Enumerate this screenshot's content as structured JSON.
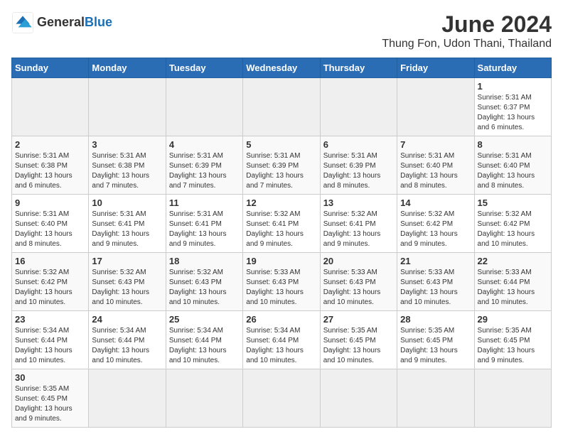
{
  "header": {
    "logo_general": "General",
    "logo_blue": "Blue",
    "title": "June 2024",
    "subtitle": "Thung Fon, Udon Thani, Thailand"
  },
  "calendar": {
    "weekdays": [
      "Sunday",
      "Monday",
      "Tuesday",
      "Wednesday",
      "Thursday",
      "Friday",
      "Saturday"
    ],
    "weeks": [
      [
        {
          "day": "",
          "empty": true
        },
        {
          "day": "",
          "empty": true
        },
        {
          "day": "",
          "empty": true
        },
        {
          "day": "",
          "empty": true
        },
        {
          "day": "",
          "empty": true
        },
        {
          "day": "",
          "empty": true
        },
        {
          "day": "1",
          "sunrise": "5:31 AM",
          "sunset": "6:37 PM",
          "daylight": "13 hours and 6 minutes."
        }
      ],
      [
        {
          "day": "2",
          "sunrise": "5:31 AM",
          "sunset": "6:38 PM",
          "daylight": "13 hours and 6 minutes."
        },
        {
          "day": "3",
          "sunrise": "5:31 AM",
          "sunset": "6:38 PM",
          "daylight": "13 hours and 7 minutes."
        },
        {
          "day": "4",
          "sunrise": "5:31 AM",
          "sunset": "6:39 PM",
          "daylight": "13 hours and 7 minutes."
        },
        {
          "day": "5",
          "sunrise": "5:31 AM",
          "sunset": "6:39 PM",
          "daylight": "13 hours and 7 minutes."
        },
        {
          "day": "6",
          "sunrise": "5:31 AM",
          "sunset": "6:39 PM",
          "daylight": "13 hours and 8 minutes."
        },
        {
          "day": "7",
          "sunrise": "5:31 AM",
          "sunset": "6:40 PM",
          "daylight": "13 hours and 8 minutes."
        },
        {
          "day": "8",
          "sunrise": "5:31 AM",
          "sunset": "6:40 PM",
          "daylight": "13 hours and 8 minutes."
        }
      ],
      [
        {
          "day": "9",
          "sunrise": "5:31 AM",
          "sunset": "6:40 PM",
          "daylight": "13 hours and 8 minutes."
        },
        {
          "day": "10",
          "sunrise": "5:31 AM",
          "sunset": "6:41 PM",
          "daylight": "13 hours and 9 minutes."
        },
        {
          "day": "11",
          "sunrise": "5:31 AM",
          "sunset": "6:41 PM",
          "daylight": "13 hours and 9 minutes."
        },
        {
          "day": "12",
          "sunrise": "5:32 AM",
          "sunset": "6:41 PM",
          "daylight": "13 hours and 9 minutes."
        },
        {
          "day": "13",
          "sunrise": "5:32 AM",
          "sunset": "6:41 PM",
          "daylight": "13 hours and 9 minutes."
        },
        {
          "day": "14",
          "sunrise": "5:32 AM",
          "sunset": "6:42 PM",
          "daylight": "13 hours and 9 minutes."
        },
        {
          "day": "15",
          "sunrise": "5:32 AM",
          "sunset": "6:42 PM",
          "daylight": "13 hours and 10 minutes."
        }
      ],
      [
        {
          "day": "16",
          "sunrise": "5:32 AM",
          "sunset": "6:42 PM",
          "daylight": "13 hours and 10 minutes."
        },
        {
          "day": "17",
          "sunrise": "5:32 AM",
          "sunset": "6:43 PM",
          "daylight": "13 hours and 10 minutes."
        },
        {
          "day": "18",
          "sunrise": "5:32 AM",
          "sunset": "6:43 PM",
          "daylight": "13 hours and 10 minutes."
        },
        {
          "day": "19",
          "sunrise": "5:33 AM",
          "sunset": "6:43 PM",
          "daylight": "13 hours and 10 minutes."
        },
        {
          "day": "20",
          "sunrise": "5:33 AM",
          "sunset": "6:43 PM",
          "daylight": "13 hours and 10 minutes."
        },
        {
          "day": "21",
          "sunrise": "5:33 AM",
          "sunset": "6:43 PM",
          "daylight": "13 hours and 10 minutes."
        },
        {
          "day": "22",
          "sunrise": "5:33 AM",
          "sunset": "6:44 PM",
          "daylight": "13 hours and 10 minutes."
        }
      ],
      [
        {
          "day": "23",
          "sunrise": "5:34 AM",
          "sunset": "6:44 PM",
          "daylight": "13 hours and 10 minutes."
        },
        {
          "day": "24",
          "sunrise": "5:34 AM",
          "sunset": "6:44 PM",
          "daylight": "13 hours and 10 minutes."
        },
        {
          "day": "25",
          "sunrise": "5:34 AM",
          "sunset": "6:44 PM",
          "daylight": "13 hours and 10 minutes."
        },
        {
          "day": "26",
          "sunrise": "5:34 AM",
          "sunset": "6:44 PM",
          "daylight": "13 hours and 10 minutes."
        },
        {
          "day": "27",
          "sunrise": "5:35 AM",
          "sunset": "6:45 PM",
          "daylight": "13 hours and 10 minutes."
        },
        {
          "day": "28",
          "sunrise": "5:35 AM",
          "sunset": "6:45 PM",
          "daylight": "13 hours and 9 minutes."
        },
        {
          "day": "29",
          "sunrise": "5:35 AM",
          "sunset": "6:45 PM",
          "daylight": "13 hours and 9 minutes."
        }
      ],
      [
        {
          "day": "30",
          "sunrise": "5:35 AM",
          "sunset": "6:45 PM",
          "daylight": "13 hours and 9 minutes."
        },
        {
          "day": "",
          "empty": true
        },
        {
          "day": "",
          "empty": true
        },
        {
          "day": "",
          "empty": true
        },
        {
          "day": "",
          "empty": true
        },
        {
          "day": "",
          "empty": true
        },
        {
          "day": "",
          "empty": true
        }
      ]
    ]
  }
}
